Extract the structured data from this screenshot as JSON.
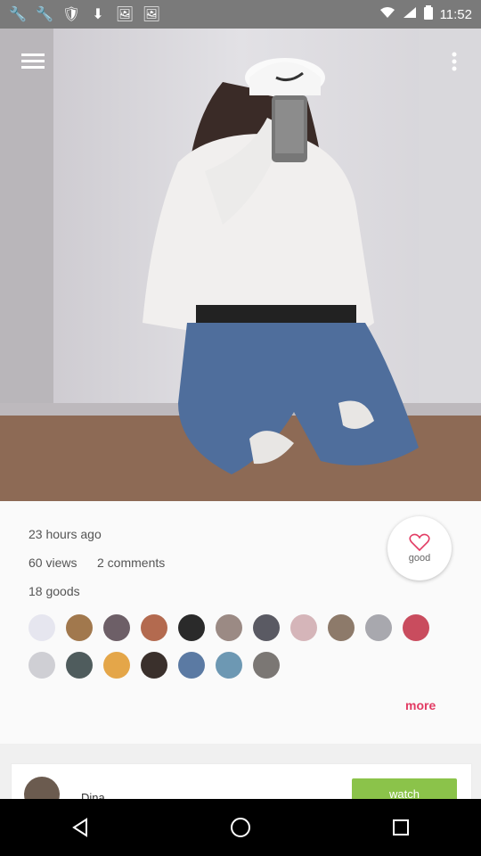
{
  "status_bar": {
    "time": "11:52",
    "icons": [
      "wrench-icon",
      "wrench-icon",
      "shield-icon",
      "download-icon",
      "image-icon",
      "image-icon"
    ],
    "right_icons": [
      "wifi-icon",
      "signal-icon",
      "battery-icon"
    ]
  },
  "top_bar": {
    "menu_icon": "hamburger-menu-icon",
    "overflow_icon": "more-vert-icon"
  },
  "post": {
    "time_ago": "23 hours ago",
    "views": "60 views",
    "comments": "2 comments",
    "goods": "18 goods",
    "good_button_label": "good",
    "more_link": "more"
  },
  "avatars_row_1": [
    {
      "color": "#e6e6ef"
    },
    {
      "color": "#a1784d"
    },
    {
      "color": "#6d5f67"
    },
    {
      "color": "#b36a4f"
    },
    {
      "color": "#2a2a2a"
    },
    {
      "color": "#9b8a84"
    },
    {
      "color": "#5a5a63"
    },
    {
      "color": "#d5b5b9"
    },
    {
      "color": "#8d7a6a"
    },
    {
      "color": "#a8a8ae"
    },
    {
      "color": "#c94c5e"
    }
  ],
  "avatars_row_2": [
    {
      "color": "#cfcfd4"
    },
    {
      "color": "#4f5c5d"
    },
    {
      "color": "#e4a649"
    },
    {
      "color": "#3a302c"
    },
    {
      "color": "#5b7aa3"
    },
    {
      "color": "#6d98b3"
    },
    {
      "color": "#7b7774"
    }
  ],
  "bottom_card": {
    "name_partial": "Dina",
    "button_partial": "watch"
  },
  "navbar": {
    "back_icon": "back-triangle-icon",
    "home_icon": "home-circle-icon",
    "recent_icon": "recent-square-icon"
  },
  "colors": {
    "accent": "#e23b63",
    "status_bar": "#7a7a7a",
    "green": "#8bc34a"
  }
}
